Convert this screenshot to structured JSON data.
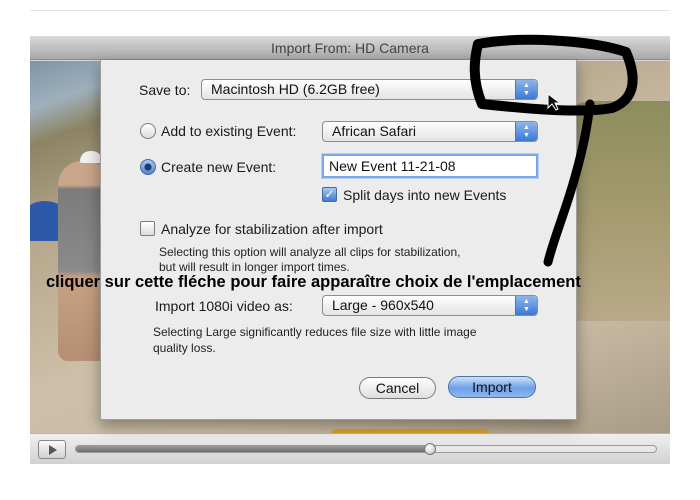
{
  "window": {
    "title": "Import From: HD Camera"
  },
  "dialog": {
    "save_to": {
      "label": "Save to:",
      "value": "Macintosh HD (6.2GB free)"
    },
    "add_existing": {
      "label": "Add to existing Event:",
      "selected": false,
      "value": "African Safari"
    },
    "create_new": {
      "label": "Create new Event:",
      "selected": true,
      "value": "New Event 11-21-08"
    },
    "split_days": {
      "label": "Split days into new Events",
      "checked": true
    },
    "analyze": {
      "label": "Analyze for stabilization after import",
      "checked": false,
      "help_line1": "Selecting this option will analyze all clips for stabilization,",
      "help_line2": "but will result in longer import times."
    },
    "import_1080i": {
      "label": "Import 1080i video as:",
      "value": "Large - 960x540",
      "help_line1": "Selecting Large significantly reduces file size with little image",
      "help_line2": "quality loss."
    },
    "cancel_label": "Cancel",
    "import_label": "Import"
  },
  "playback": {
    "progress": 0.61
  },
  "annotation": {
    "text": "cliquer sur cette fléche pour faire apparaître choix de l'emplacement"
  },
  "icons": {
    "play": "play-icon",
    "popup_arrows": "chevron-up-down-icon",
    "checkmark": "checkmark-icon"
  },
  "colors": {
    "accent": "#3b78d4",
    "marker": "#000000"
  }
}
